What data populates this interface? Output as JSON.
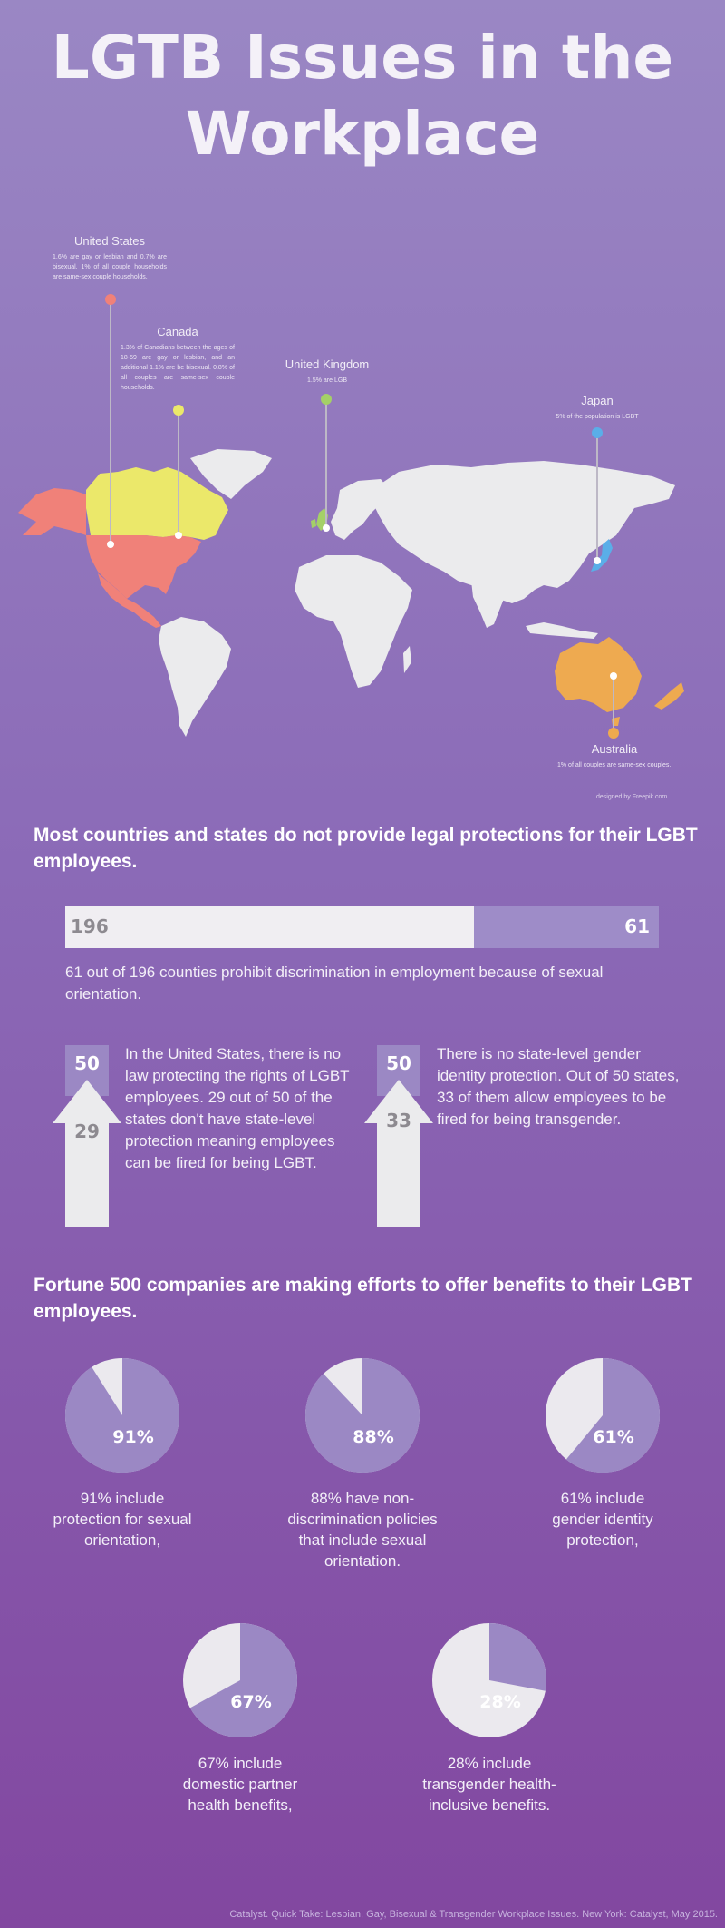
{
  "title": "LGTB Issues in the Workplace",
  "map": {
    "credit": "designed by Freepik.com",
    "colors": {
      "land": "#ebebed",
      "us": "#f08179",
      "canada": "#ebe86a",
      "uk": "#a4d067",
      "japan": "#5aaee8",
      "australia": "#eeaa50"
    },
    "countries": [
      {
        "name": "United States",
        "desc": "1.6% are gay or lesbian and 0.7% are bisexual. 1% of all couple households are same-sex couple households."
      },
      {
        "name": "Canada",
        "desc": "1.3% of Canadians between the ages of 18-59 are gay or lesbian, and an additional 1.1% are be bisexual. 0.8% of all couples are same-sex couple households."
      },
      {
        "name": "United Kingdom",
        "desc": "1.5% are LGB"
      },
      {
        "name": "Japan",
        "desc": "5% of the population is LGBT"
      },
      {
        "name": "Australia",
        "desc": "1% of all couples are same-sex couples."
      }
    ]
  },
  "section1": {
    "heading": "Most countries and states do not provide legal protections for their LGBT employees.",
    "bar": {
      "total": 196,
      "part": 61,
      "caption": "61 out of 196 counties prohibit discrimination in employment because of sexual orientation."
    },
    "arrows": [
      {
        "top": "50",
        "bottom": "29",
        "text": "In the United States, there is no law protecting the rights of LGBT employees. 29 out of 50 of the states don't have state-level protection meaning employees can be fired for being LGBT."
      },
      {
        "top": "50",
        "bottom": "33",
        "text": "There is no state-level gender identity protection. Out of 50 states, 33 of them allow employees to be fired for being transgender."
      }
    ]
  },
  "section2": {
    "heading": "Fortune 500 companies are making efforts to offer benefits to their LGBT employees.",
    "pies": [
      {
        "value": 91,
        "label": "91%",
        "caption": "91% include protection for sexual orientation,"
      },
      {
        "value": 88,
        "label": "88%",
        "caption": "88% have non-discrimination policies that include sexual orientation."
      },
      {
        "value": 61,
        "label": "61%",
        "caption": "61% include gender identity protection,"
      },
      {
        "value": 67,
        "label": "67%",
        "caption": "67% include domestic partner health benefits,"
      },
      {
        "value": 28,
        "label": "28%",
        "caption": "28% include transgender health-inclusive benefits."
      }
    ],
    "colors": {
      "filled": "#9b88c4",
      "empty": "#ebe9ee"
    }
  },
  "footer": "Catalyst. Quick Take: Lesbian, Gay, Bisexual & Transgender Workplace Issues. New York: Catalyst, May 2015."
}
